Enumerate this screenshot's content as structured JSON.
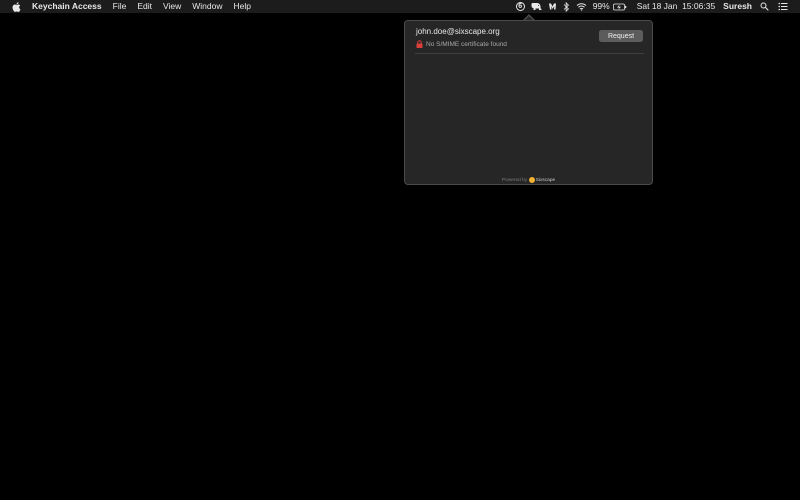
{
  "menubar": {
    "apple_icon": "apple-icon",
    "app_name": "Keychain Access",
    "menus": [
      "File",
      "Edit",
      "View",
      "Window",
      "Help"
    ],
    "status": {
      "sixscape_badge": "6",
      "battery_percent": "99%",
      "datetime": "Sat 18 Jan  15:06:35",
      "user": "Suresh"
    }
  },
  "popover": {
    "email": "john.doe@sixscape.org",
    "cert_status": "No S/MIME certificate found",
    "request_label": "Request",
    "powered_by": "Powered by",
    "brand": "Sixscape"
  },
  "colors": {
    "background": "#000000",
    "menubar": "#1c1c1c",
    "popover_bg": "#262626",
    "button_bg": "#5c5c5c",
    "lock_red": "#d9403a",
    "brand_yellow": "#f2b233"
  }
}
